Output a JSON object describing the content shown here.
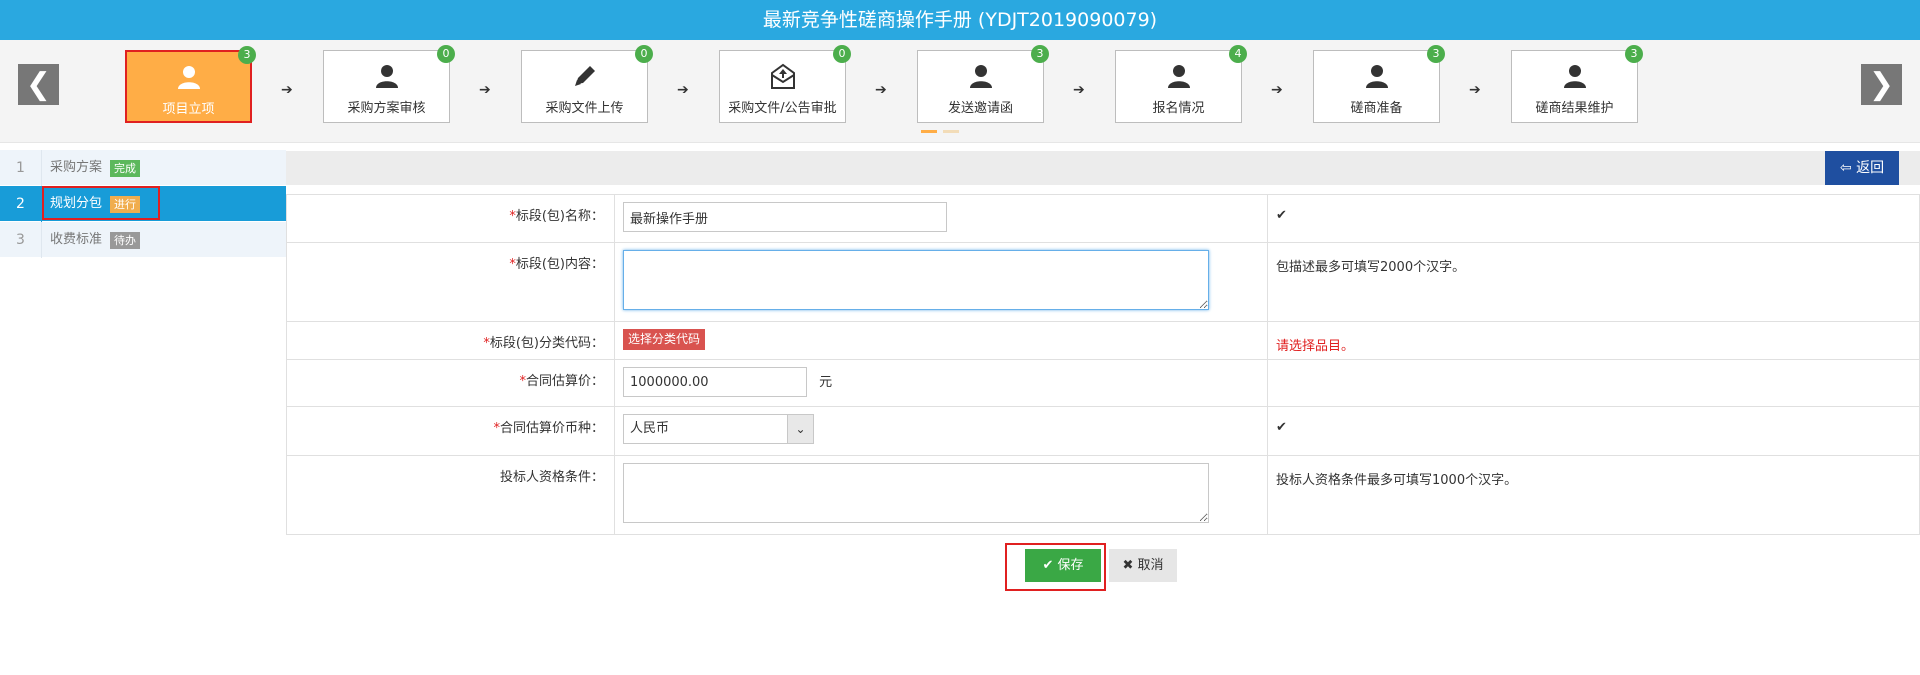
{
  "title": "最新竞争性磋商操作手册 (YDJT2019090079)",
  "nav": {
    "prev_icon": "chevron-left-icon",
    "next_icon": "chevron-right-icon",
    "prev_glyph": "❮",
    "next_glyph": "❯"
  },
  "steps": [
    {
      "label": "项目立项",
      "count": "3",
      "icon": "user-icon",
      "active": true
    },
    {
      "label": "采购方案审核",
      "count": "0",
      "icon": "user-icon"
    },
    {
      "label": "采购文件上传",
      "count": "0",
      "icon": "pencil-icon"
    },
    {
      "label": "采购文件/公告审批",
      "count": "0",
      "icon": "envelope-upload-icon"
    },
    {
      "label": "发送邀请函",
      "count": "3",
      "icon": "user-icon"
    },
    {
      "label": "报名情况",
      "count": "4",
      "icon": "user-icon"
    },
    {
      "label": "磋商准备",
      "count": "3",
      "icon": "user-icon"
    },
    {
      "label": "磋商结果维护",
      "count": "3",
      "icon": "user-icon"
    }
  ],
  "step_arrow": "➔",
  "sidebar": [
    {
      "num": "1",
      "label": "采购方案",
      "tag": "完成",
      "tag_color": "#5cb85c"
    },
    {
      "num": "2",
      "label": "规划分包",
      "tag": "进行",
      "tag_color": "#f0ad4e",
      "active": true
    },
    {
      "num": "3",
      "label": "收费标准",
      "tag": "待办",
      "tag_color": "#999999"
    }
  ],
  "back_button": {
    "icon": "circle-arrow-left-icon",
    "glyph": "⇦",
    "label": "返回"
  },
  "form": {
    "required_mark": "*",
    "rows": {
      "name": {
        "label": "标段(包)名称：",
        "value": "最新操作手册",
        "hint": "✔"
      },
      "content": {
        "label": "标段(包)内容：",
        "value": "",
        "hint": "包描述最多可填写2000个汉字。"
      },
      "category": {
        "label": "标段(包)分类代码：",
        "button": "选择分类代码",
        "hint": "请选择品目。"
      },
      "price": {
        "label": "合同估算价：",
        "value": "1000000.00",
        "unit": "元"
      },
      "currency": {
        "label": "合同估算价币种：",
        "value": "人民币",
        "hint": "✔",
        "arrow": "⌄"
      },
      "qualification": {
        "label": "投标人资格条件：",
        "value": "",
        "hint": "投标人资格条件最多可填写1000个汉字。"
      }
    }
  },
  "actions": {
    "save": {
      "icon": "check-icon",
      "glyph": "✔",
      "label": "保存"
    },
    "cancel": {
      "icon": "close-icon",
      "glyph": "✖",
      "label": "取消"
    }
  },
  "colors": {
    "header": "#2aa8e0",
    "active_step": "#ffad46",
    "sidebar_active": "#189cd8",
    "back": "#1f4fa0",
    "save": "#3aa845",
    "error": "#e02020"
  }
}
